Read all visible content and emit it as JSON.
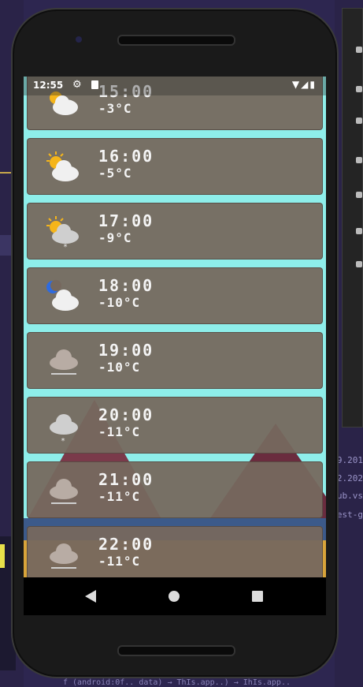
{
  "status_bar": {
    "time": "12:55",
    "settings_icon": "gear-icon",
    "sd_icon": "sd-card-icon",
    "wifi_icon": "wifi-icon",
    "signal_icon": "signal-icon",
    "battery_icon": "battery-icon"
  },
  "forecast": [
    {
      "time": "15:00",
      "temp": "-3°C",
      "icon": "sun-cloud-icon"
    },
    {
      "time": "16:00",
      "temp": "-5°C",
      "icon": "sun-cloud-icon"
    },
    {
      "time": "17:00",
      "temp": "-9°C",
      "icon": "sun-cloud-snow-icon"
    },
    {
      "time": "18:00",
      "temp": "-10°C",
      "icon": "moon-cloud-icon"
    },
    {
      "time": "19:00",
      "temp": "-10°C",
      "icon": "fog-icon"
    },
    {
      "time": "20:00",
      "temp": "-11°C",
      "icon": "cloud-snow-icon"
    },
    {
      "time": "21:00",
      "temp": "-11°C",
      "icon": "fog-icon"
    },
    {
      "time": "22:00",
      "temp": "-11°C",
      "icon": "fog-icon"
    }
  ],
  "nav": {
    "back_icon": "back-icon",
    "home_icon": "home-icon",
    "recents_icon": "recents-icon"
  },
  "desktop": {
    "right_texts": [
      "9.201",
      "2.202",
      "ub.vs",
      "est-g"
    ],
    "bottom_text": "f (android:0f.. data) → ThIs.app..) → IhIs.app.."
  }
}
